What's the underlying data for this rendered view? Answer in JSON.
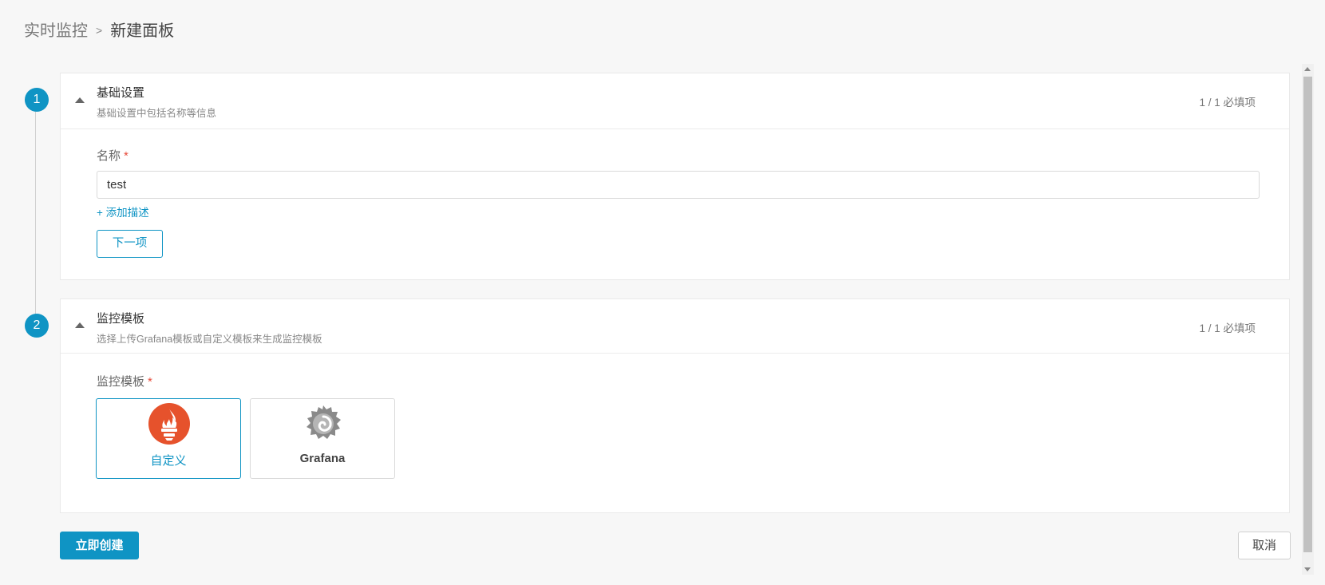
{
  "breadcrumb": {
    "parent": "实时监控",
    "separator": ">",
    "current": "新建面板"
  },
  "steps": [
    {
      "number": "1",
      "title": "基础设置",
      "subtitle": "基础设置中包括名称等信息",
      "count": "1 / 1 必填项"
    },
    {
      "number": "2",
      "title": "监控模板",
      "subtitle": "选择上传Grafana模板或自定义模板来生成监控模板",
      "count": "1 / 1 必填项"
    }
  ],
  "basic": {
    "name_label": "名称",
    "required_mark": "*",
    "name_value": "test",
    "add_desc": "+ 添加描述",
    "next_button": "下一项"
  },
  "template": {
    "label": "监控模板",
    "required_mark": "*",
    "options": [
      {
        "label": "自定义",
        "icon": "prometheus-icon",
        "selected": true
      },
      {
        "label": "Grafana",
        "icon": "grafana-icon",
        "selected": false
      }
    ]
  },
  "actions": {
    "create": "立即创建",
    "cancel": "取消"
  },
  "colors": {
    "accent": "#0f94c4",
    "required": "#e74c3c",
    "prometheus": "#e6522c",
    "grafana": "#8a8a8a"
  }
}
